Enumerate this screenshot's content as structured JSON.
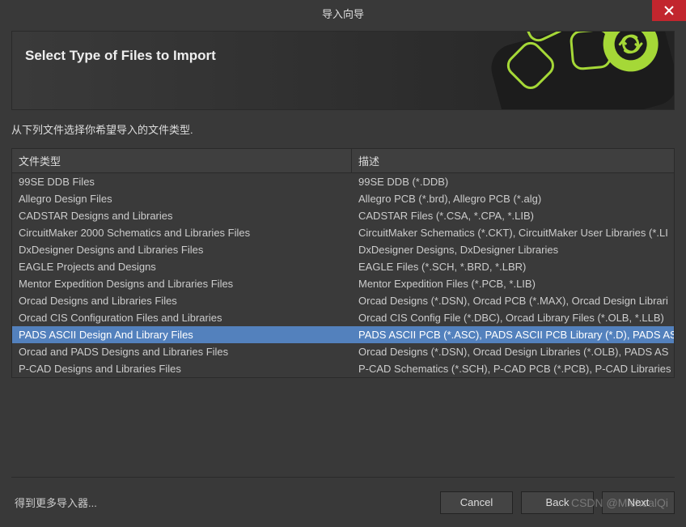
{
  "titlebar": {
    "title": "导入向导"
  },
  "header": {
    "title": "Select Type of Files to Import"
  },
  "instruction": "从下列文件选择你希望导入的文件类型.",
  "table": {
    "col1_header": "文件类型",
    "col2_header": "描述",
    "rows": [
      {
        "type": "99SE DDB Files",
        "desc": "99SE DDB (*.DDB)",
        "selected": false
      },
      {
        "type": "Allegro Design Files",
        "desc": "Allegro PCB (*.brd), Allegro PCB (*.alg)",
        "selected": false
      },
      {
        "type": "CADSTAR Designs and Libraries",
        "desc": "CADSTAR Files (*.CSA, *.CPA, *.LIB)",
        "selected": false
      },
      {
        "type": "CircuitMaker 2000 Schematics and Libraries Files",
        "desc": "CircuitMaker Schematics (*.CKT), CircuitMaker User Libraries (*.LI",
        "selected": false
      },
      {
        "type": "DxDesigner Designs and Libraries Files",
        "desc": "DxDesigner Designs, DxDesigner Libraries",
        "selected": false
      },
      {
        "type": "EAGLE Projects and Designs",
        "desc": "EAGLE Files (*.SCH, *.BRD, *.LBR)",
        "selected": false
      },
      {
        "type": "Mentor Expedition Designs and Libraries Files",
        "desc": "Mentor Expedition Files (*.PCB, *.LIB)",
        "selected": false
      },
      {
        "type": "Orcad Designs and Libraries Files",
        "desc": "Orcad Designs (*.DSN), Orcad PCB (*.MAX), Orcad Design Librari",
        "selected": false
      },
      {
        "type": "Orcad CIS Configuration Files and Libraries",
        "desc": "Orcad CIS Config File (*.DBC), Orcad Library Files (*.OLB, *.LLB)",
        "selected": false
      },
      {
        "type": "PADS ASCII Design And Library Files",
        "desc": "PADS ASCII PCB (*.ASC), PADS ASCII PCB Library (*.D), PADS AS",
        "selected": true
      },
      {
        "type": "Orcad and PADS Designs and Libraries Files",
        "desc": "Orcad Designs (*.DSN), Orcad Design Libraries (*.OLB), PADS AS",
        "selected": false
      },
      {
        "type": "P-CAD Designs and Libraries Files",
        "desc": "P-CAD Schematics (*.SCH), P-CAD PCB (*.PCB), P-CAD Libraries",
        "selected": false
      }
    ]
  },
  "footer": {
    "link": "得到更多导入器...",
    "cancel": "Cancel",
    "back": "Back",
    "next": "Next"
  },
  "watermark": "CSDN @MichealQi"
}
